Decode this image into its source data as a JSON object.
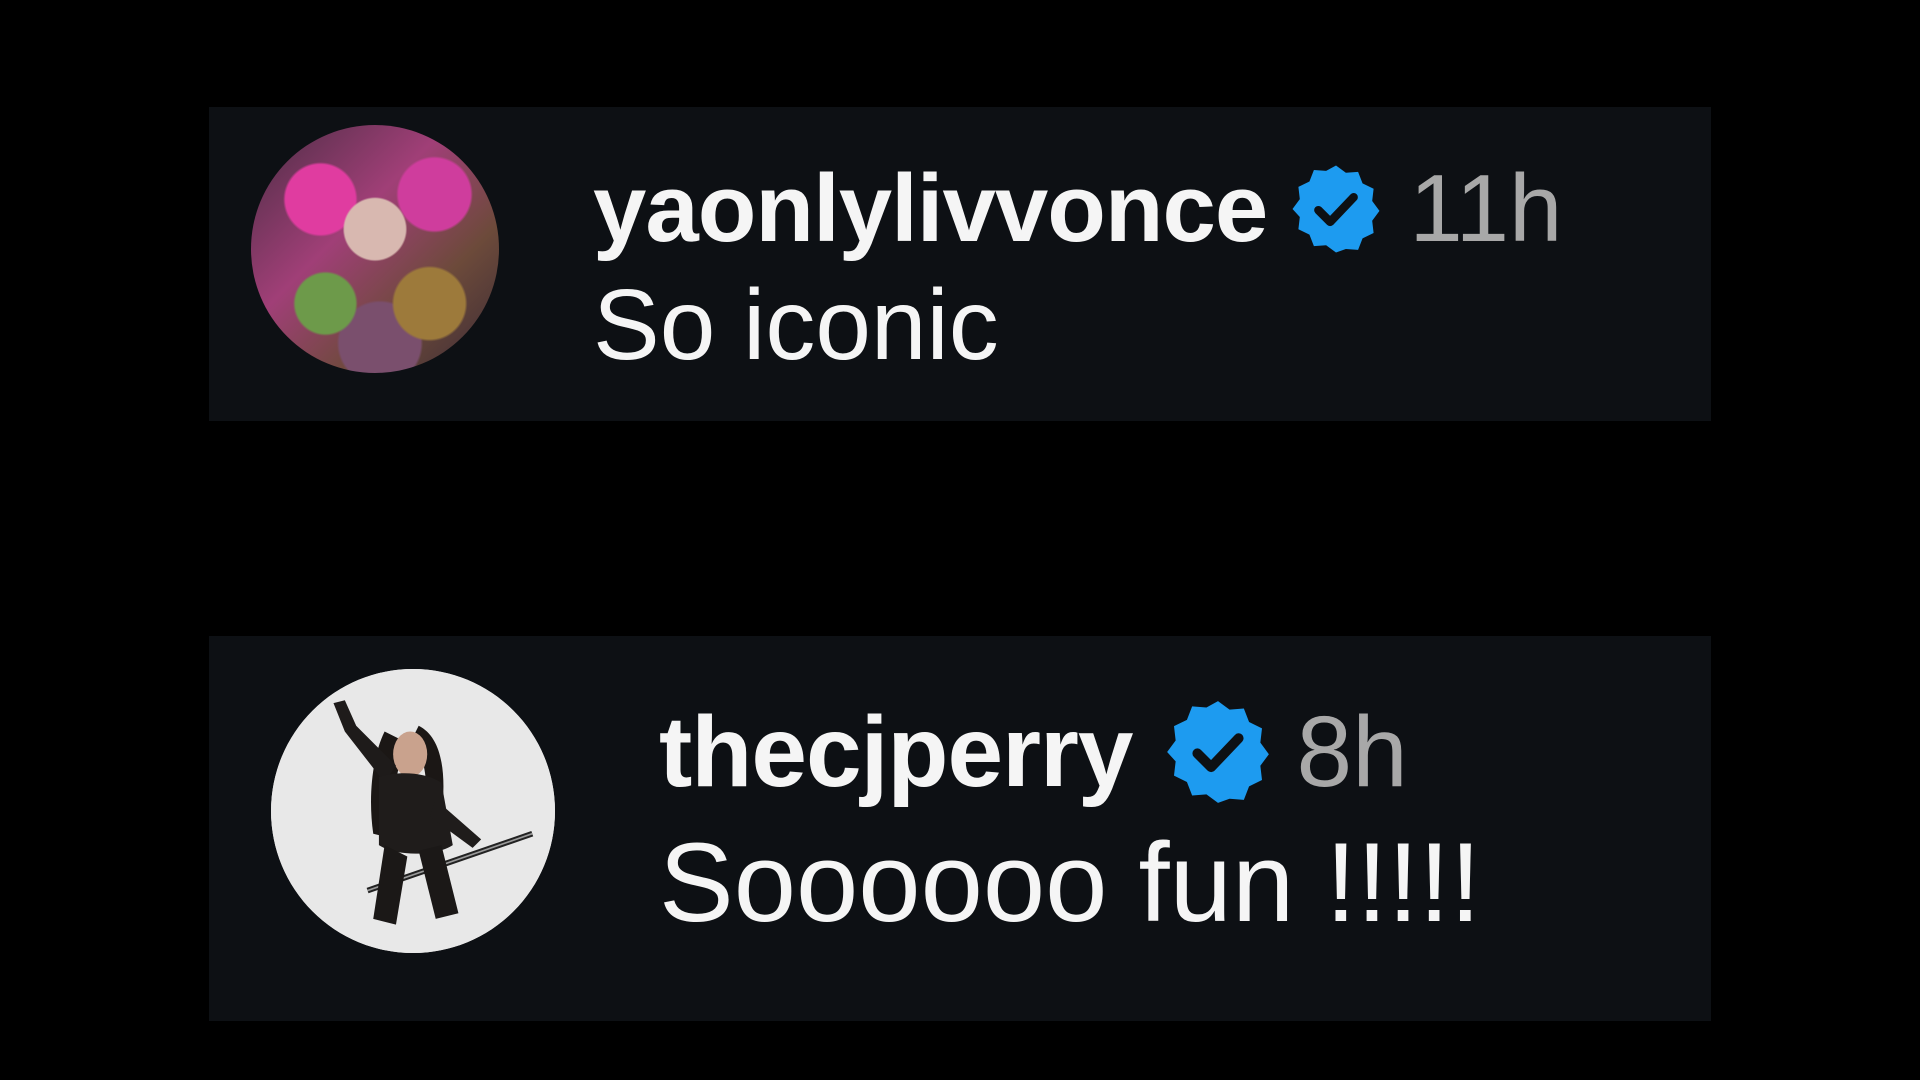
{
  "comments": [
    {
      "username": "yaonlylivvonce",
      "verified": true,
      "timestamp": "11h",
      "text": "So iconic",
      "avatar_icon": "profile-photo-colorful-art"
    },
    {
      "username": "thecjperry",
      "verified": true,
      "timestamp": "8h",
      "text": "Soooooo fun !!!!!",
      "avatar_icon": "profile-photo-person-posing"
    }
  ],
  "colors": {
    "background": "#000000",
    "comment_background": "#0d1014",
    "username": "#f5f5f5",
    "timestamp": "#a8a8a8",
    "verified_badge": "#1d9bf0"
  }
}
